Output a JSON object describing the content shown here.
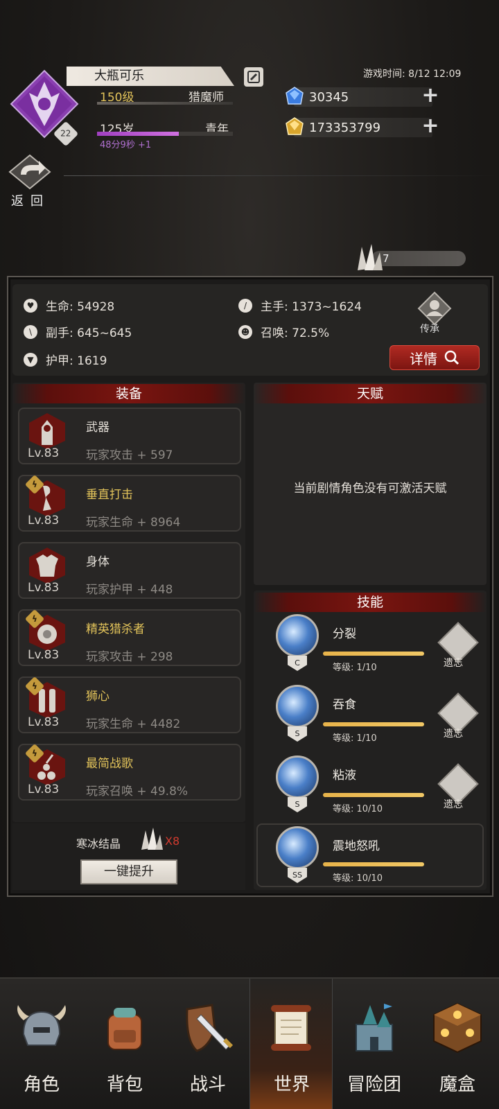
{
  "header": {
    "player_name": "大瓶可乐",
    "level": "150级",
    "class": "猎魔师",
    "age": "125岁",
    "age_stage": "青年",
    "age_progress": 0.6,
    "age_timer": "48分9秒 +1",
    "emblem_badge": "22",
    "return_label": "返回",
    "game_time": "游戏时间: 8/12 12:09"
  },
  "resources": {
    "gems": "30345",
    "gold": "173353799",
    "crystal_count": "7"
  },
  "stats": {
    "hp": "生命: 54928",
    "main_hand": "主手: 1373~1624",
    "off_hand": "副手: 645~645",
    "summon": "召唤: 72.5%",
    "armor": "护甲: 1619",
    "inherit_label": "传承",
    "detail_label": "详情"
  },
  "equipment": {
    "title": "装备",
    "items": [
      {
        "name": "武器",
        "level": "Lv.83",
        "bonus": "玩家攻击 + 597",
        "icon": "weapon-icon",
        "special": false
      },
      {
        "name": "垂直打击",
        "level": "Lv.83",
        "bonus": "玩家生命 + 8964",
        "icon": "strike-icon",
        "special": true
      },
      {
        "name": "身体",
        "level": "Lv.83",
        "bonus": "玩家护甲 + 448",
        "icon": "body-armor-icon",
        "special": false
      },
      {
        "name": "精英猎杀者",
        "level": "Lv.83",
        "bonus": "玩家攻击 + 298",
        "icon": "hunter-icon",
        "special": true
      },
      {
        "name": "狮心",
        "level": "Lv.83",
        "bonus": "玩家生命 + 4482",
        "icon": "lionheart-icon",
        "special": true
      },
      {
        "name": "最简战歌",
        "level": "Lv.83",
        "bonus": "玩家召唤 + 49.8%",
        "icon": "warsong-icon",
        "special": true
      }
    ],
    "ice_label": "寒冰结晶",
    "ice_count": "X8",
    "upgrade_label": "一键提升"
  },
  "talent": {
    "title": "天赋",
    "message": "当前剧情角色没有可激活天赋"
  },
  "skills": {
    "title": "技能",
    "forget_label": "遗忘",
    "items": [
      {
        "name": "分裂",
        "grade": "C",
        "level": "等级: 1/10",
        "progress": 1.0
      },
      {
        "name": "吞食",
        "grade": "S",
        "level": "等级: 1/10",
        "progress": 1.0
      },
      {
        "name": "粘液",
        "grade": "S",
        "level": "等级: 10/10",
        "progress": 1.0
      },
      {
        "name": "震地怒吼",
        "grade": "SS",
        "level": "等级: 10/10",
        "progress": 1.0
      }
    ]
  },
  "nav": {
    "items": [
      {
        "label": "角色",
        "icon": "helmet-icon"
      },
      {
        "label": "背包",
        "icon": "backpack-icon"
      },
      {
        "label": "战斗",
        "icon": "sword-shield-icon"
      },
      {
        "label": "世界",
        "icon": "scroll-icon"
      },
      {
        "label": "冒险团",
        "icon": "castle-icon"
      },
      {
        "label": "魔盒",
        "icon": "magic-box-icon"
      }
    ],
    "active_index": 3
  }
}
